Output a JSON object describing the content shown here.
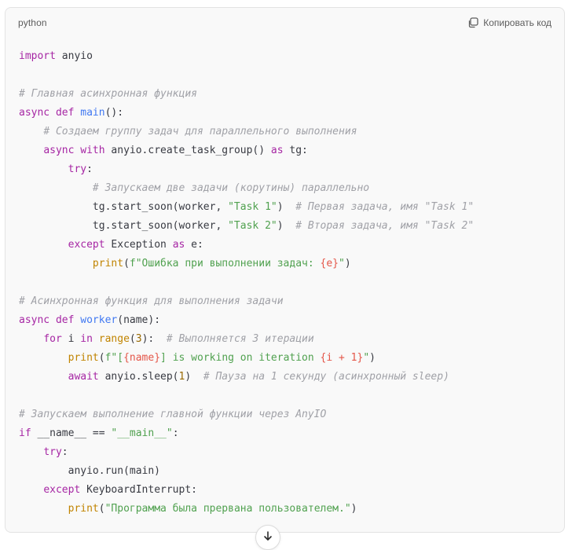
{
  "code_block": {
    "language": "python",
    "copy_label": "Копировать код",
    "lines": [
      [
        [
          "keyword",
          "import"
        ],
        [
          "plain",
          " anyio"
        ]
      ],
      [],
      [
        [
          "comment",
          "# Главная асинхронная функция"
        ]
      ],
      [
        [
          "keyword",
          "async"
        ],
        [
          "plain",
          " "
        ],
        [
          "keyword",
          "def"
        ],
        [
          "plain",
          " "
        ],
        [
          "func",
          "main"
        ],
        [
          "plain",
          "():"
        ]
      ],
      [
        [
          "plain",
          "    "
        ],
        [
          "comment",
          "# Создаем группу задач для параллельного выполнения"
        ]
      ],
      [
        [
          "plain",
          "    "
        ],
        [
          "keyword",
          "async"
        ],
        [
          "plain",
          " "
        ],
        [
          "keyword",
          "with"
        ],
        [
          "plain",
          " anyio.create_task_group() "
        ],
        [
          "keyword",
          "as"
        ],
        [
          "plain",
          " tg:"
        ]
      ],
      [
        [
          "plain",
          "        "
        ],
        [
          "keyword",
          "try"
        ],
        [
          "plain",
          ":"
        ]
      ],
      [
        [
          "plain",
          "            "
        ],
        [
          "comment",
          "# Запускаем две задачи (корутины) параллельно"
        ]
      ],
      [
        [
          "plain",
          "            tg.start_soon(worker, "
        ],
        [
          "string",
          "\"Task 1\""
        ],
        [
          "plain",
          ")  "
        ],
        [
          "comment",
          "# Первая задача, имя \"Task 1\""
        ]
      ],
      [
        [
          "plain",
          "            tg.start_soon(worker, "
        ],
        [
          "string",
          "\"Task 2\""
        ],
        [
          "plain",
          ")  "
        ],
        [
          "comment",
          "# Вторая задача, имя \"Task 2\""
        ]
      ],
      [
        [
          "plain",
          "        "
        ],
        [
          "keyword",
          "except"
        ],
        [
          "plain",
          " Exception "
        ],
        [
          "keyword",
          "as"
        ],
        [
          "plain",
          " e:"
        ]
      ],
      [
        [
          "plain",
          "            "
        ],
        [
          "builtin",
          "print"
        ],
        [
          "plain",
          "("
        ],
        [
          "string",
          "f\"Ошибка при выполнении задач: "
        ],
        [
          "interp",
          "{e}"
        ],
        [
          "string",
          "\""
        ],
        [
          "plain",
          ")"
        ]
      ],
      [],
      [
        [
          "comment",
          "# Асинхронная функция для выполнения задачи"
        ]
      ],
      [
        [
          "keyword",
          "async"
        ],
        [
          "plain",
          " "
        ],
        [
          "keyword",
          "def"
        ],
        [
          "plain",
          " "
        ],
        [
          "func",
          "worker"
        ],
        [
          "plain",
          "(name):"
        ]
      ],
      [
        [
          "plain",
          "    "
        ],
        [
          "keyword",
          "for"
        ],
        [
          "plain",
          " i "
        ],
        [
          "keyword",
          "in"
        ],
        [
          "plain",
          " "
        ],
        [
          "builtin",
          "range"
        ],
        [
          "plain",
          "("
        ],
        [
          "number",
          "3"
        ],
        [
          "plain",
          "):  "
        ],
        [
          "comment",
          "# Выполняется 3 итерации"
        ]
      ],
      [
        [
          "plain",
          "        "
        ],
        [
          "builtin",
          "print"
        ],
        [
          "plain",
          "("
        ],
        [
          "string",
          "f\"["
        ],
        [
          "interp",
          "{name}"
        ],
        [
          "string",
          "] is working on iteration "
        ],
        [
          "interp",
          "{i + 1}"
        ],
        [
          "string",
          "\""
        ],
        [
          "plain",
          ")"
        ]
      ],
      [
        [
          "plain",
          "        "
        ],
        [
          "keyword",
          "await"
        ],
        [
          "plain",
          " anyio.sleep("
        ],
        [
          "number",
          "1"
        ],
        [
          "plain",
          ")  "
        ],
        [
          "comment",
          "# Пауза на 1 секунду (асинхронный sleep)"
        ]
      ],
      [],
      [
        [
          "comment",
          "# Запускаем выполнение главной функции через AnyIO"
        ]
      ],
      [
        [
          "keyword",
          "if"
        ],
        [
          "plain",
          " __name__ == "
        ],
        [
          "string",
          "\"__main__\""
        ],
        [
          "plain",
          ":"
        ]
      ],
      [
        [
          "plain",
          "    "
        ],
        [
          "keyword",
          "try"
        ],
        [
          "plain",
          ":"
        ]
      ],
      [
        [
          "plain",
          "        anyio.run(main)"
        ]
      ],
      [
        [
          "plain",
          "    "
        ],
        [
          "keyword",
          "except"
        ],
        [
          "plain",
          " KeyboardInterrupt:"
        ]
      ],
      [
        [
          "plain",
          "        "
        ],
        [
          "builtin",
          "print"
        ],
        [
          "plain",
          "("
        ],
        [
          "string",
          "\"Программа была прервана пользователем.\""
        ],
        [
          "plain",
          ")"
        ]
      ]
    ]
  },
  "colors": {
    "keyword": "#a626a4",
    "function": "#4078f2",
    "builtin": "#c18401",
    "string": "#50a14f",
    "comment": "#a0a1a7",
    "number": "#986801",
    "interpolation": "#e45649"
  },
  "icons": {
    "copy": "copy-icon",
    "scroll_down": "arrow-down-icon"
  }
}
